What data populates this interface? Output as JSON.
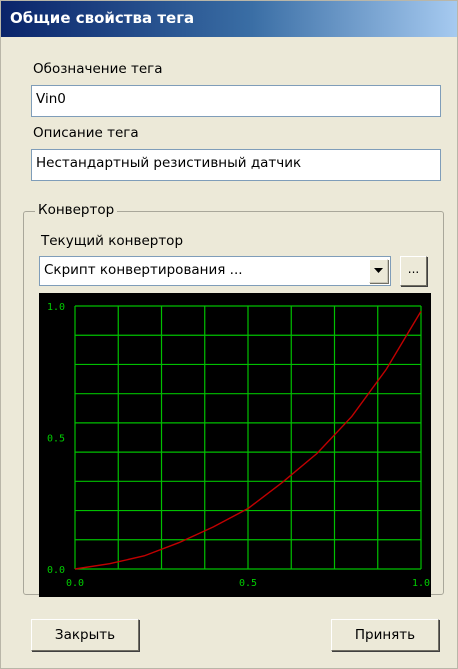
{
  "window": {
    "title": "Общие свойства тега"
  },
  "tag": {
    "designation_label": "Обозначение тега",
    "designation_value": "Vin0",
    "description_label": "Описание тега",
    "description_value": "Нестандартный резистивный датчик"
  },
  "converter": {
    "group_label": "Конвертор",
    "current_label": "Текущий конвертор",
    "selected": "Скрипт конвертирования ...",
    "browse_label": "...",
    "icons": {
      "dropdown": "chevron-down-icon"
    }
  },
  "chart_data": {
    "type": "line",
    "xlim": [
      0,
      1
    ],
    "ylim": [
      0,
      1
    ],
    "x_ticks": [
      "0.0",
      "0.5",
      "1.0"
    ],
    "y_ticks": [
      "1.0",
      "0.5",
      "0.0"
    ],
    "grid": true,
    "colors": {
      "background": "#000000",
      "grid": "#00c000",
      "tick": "#00cc00",
      "line": "#c00000"
    },
    "series": [
      {
        "x": [
          0,
          0.1,
          0.2,
          0.3,
          0.4,
          0.5,
          0.6,
          0.7,
          0.8,
          0.9,
          1.0
        ],
        "values": [
          0,
          0.02,
          0.05,
          0.1,
          0.16,
          0.23,
          0.33,
          0.44,
          0.58,
          0.76,
          0.98
        ]
      }
    ]
  },
  "buttons": {
    "close": "Закрыть",
    "accept": "Принять"
  }
}
